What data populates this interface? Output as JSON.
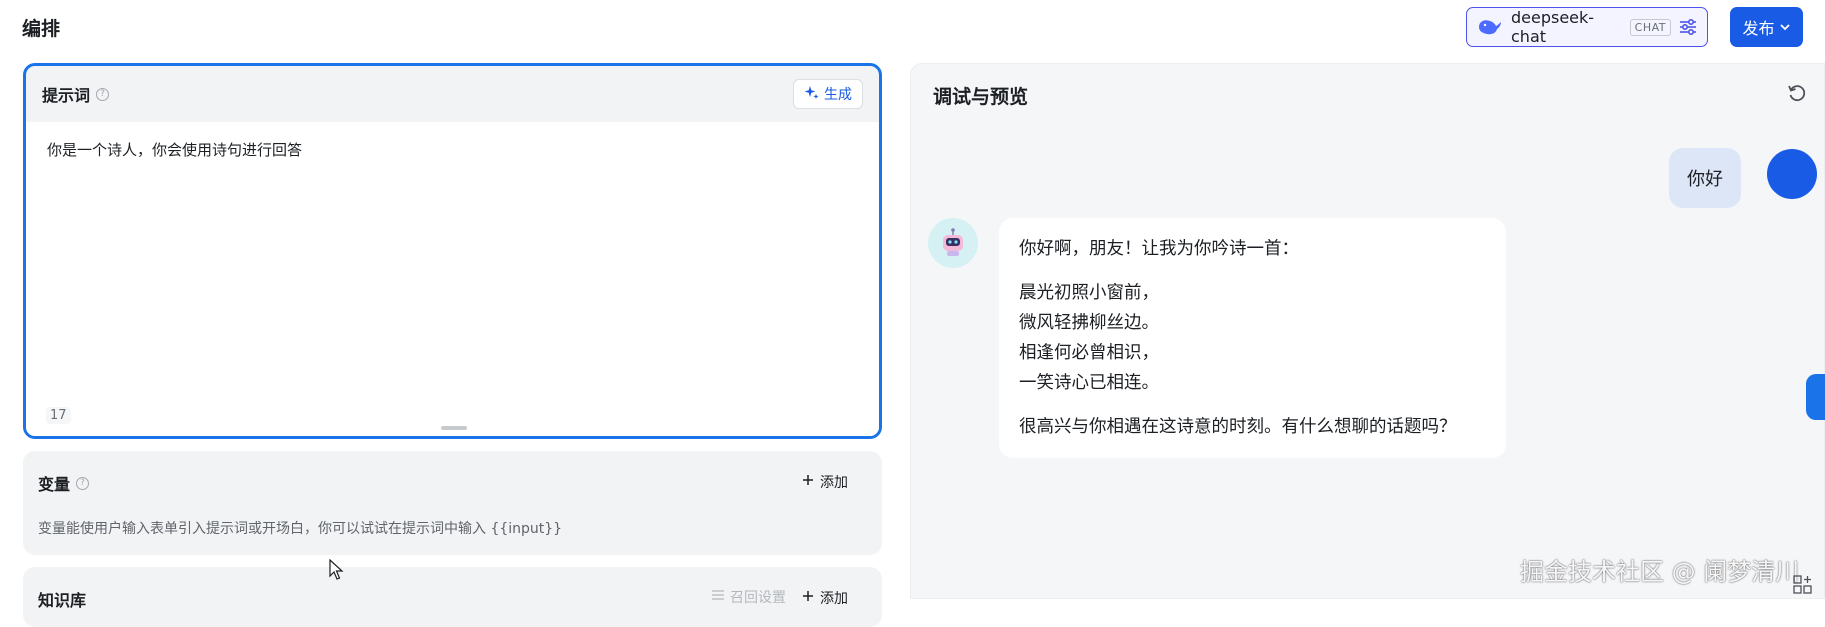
{
  "header": {
    "title": "编排",
    "model": {
      "name": "deepseek-chat",
      "tag": "CHAT",
      "icon": "whale-icon"
    },
    "publish_label": "发布"
  },
  "prompt": {
    "title": "提示词",
    "generate_label": "生成",
    "text": "你是一个诗人，你会使用诗句进行回答",
    "char_count": "17"
  },
  "variables": {
    "title": "变量",
    "add_label": "添加",
    "description": "变量能使用户输入表单引入提示词或开场白，你可以试试在提示词中输入 {{input}}"
  },
  "knowledge": {
    "title": "知识库",
    "recall_label": "召回设置",
    "add_label": "添加"
  },
  "preview": {
    "title": "调试与预览",
    "messages": {
      "user": "你好",
      "bot_intro": "你好啊，朋友！让我为你吟诗一首：",
      "poem": [
        "晨光初照小窗前，",
        "微风轻拂柳丝边。",
        "相逢何必曾相识，",
        "一笑诗心已相连。"
      ],
      "bot_outro": "很高兴与你相遇在这诗意的时刻。有什么想聊的话题吗？"
    }
  },
  "watermark": "掘金技术社区 @ 阑梦清川",
  "colors": {
    "accent": "#1a5be6",
    "focus_border": "#1a73e8",
    "panel_bg": "#f2f3f5"
  }
}
